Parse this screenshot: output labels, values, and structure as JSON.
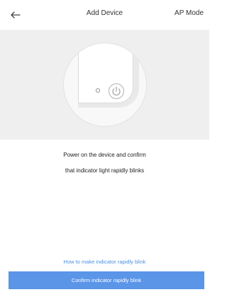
{
  "header": {
    "back_icon": "arrow-left-icon",
    "title": "Add Device",
    "right_action": "AP Mode"
  },
  "hero": {
    "illustration": "device-power-indicator-illustration",
    "icons": [
      "indicator-light-icon",
      "power-icon"
    ]
  },
  "instructions": {
    "line1": "Power on the device and confirm",
    "line2": "that indicator light rapidly blinks"
  },
  "help": {
    "link_text": "How to make indicator rapidly blink"
  },
  "footer": {
    "confirm_label": "Confirm indicator rapidly blink",
    "confirm_color": "#5a95e8"
  },
  "colors": {
    "background": "#ffffff",
    "hero_background": "#efefef",
    "link": "#4a90e2",
    "text": "#222222"
  }
}
